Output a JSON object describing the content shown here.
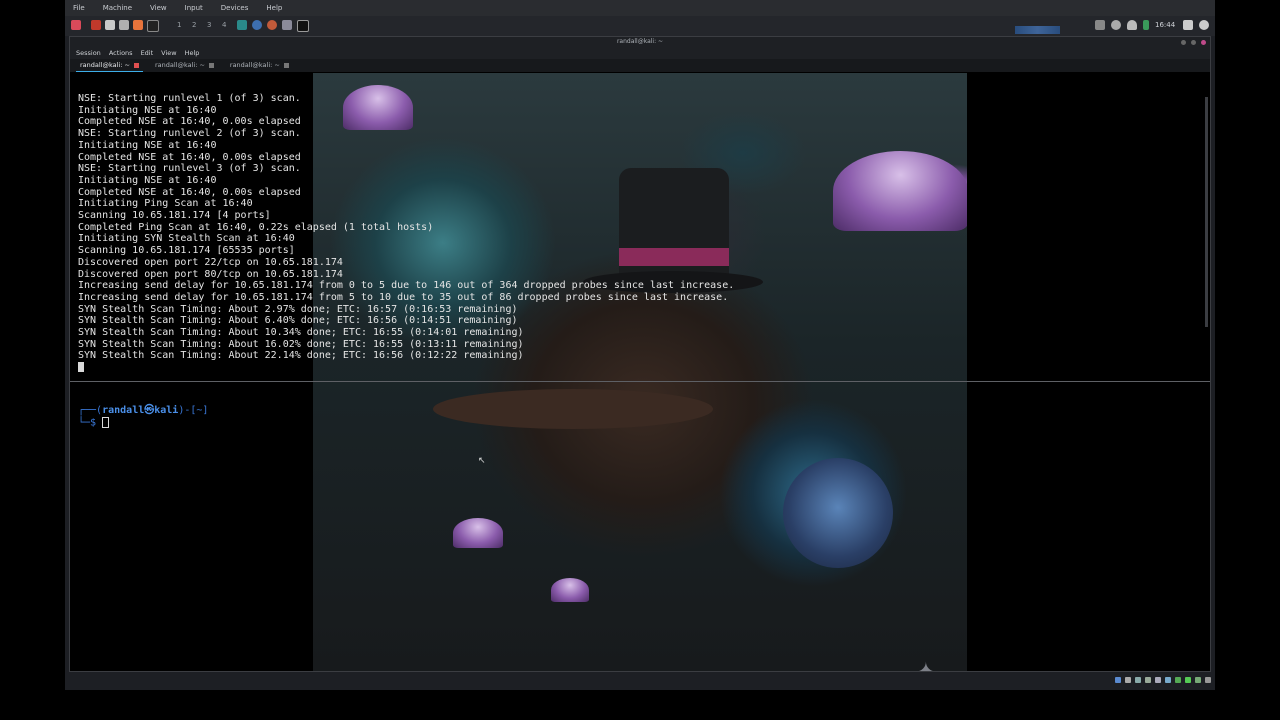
{
  "vbox_menu": [
    "File",
    "Machine",
    "View",
    "Input",
    "Devices",
    "Help"
  ],
  "panel": {
    "workspaces": [
      "1",
      "2",
      "3",
      "4"
    ],
    "clock": "16:44"
  },
  "terminal": {
    "title": "randall@kali: ~",
    "menu": [
      "Session",
      "Actions",
      "Edit",
      "View",
      "Help"
    ],
    "tabs": [
      "randall@kali: ~",
      "randall@kali: ~",
      "randall@kali: ~"
    ],
    "output_lines": [
      "NSE: Starting runlevel 1 (of 3) scan.",
      "Initiating NSE at 16:40",
      "Completed NSE at 16:40, 0.00s elapsed",
      "NSE: Starting runlevel 2 (of 3) scan.",
      "Initiating NSE at 16:40",
      "Completed NSE at 16:40, 0.00s elapsed",
      "NSE: Starting runlevel 3 (of 3) scan.",
      "Initiating NSE at 16:40",
      "Completed NSE at 16:40, 0.00s elapsed",
      "Initiating Ping Scan at 16:40",
      "Scanning 10.65.181.174 [4 ports]",
      "Completed Ping Scan at 16:40, 0.22s elapsed (1 total hosts)",
      "Initiating SYN Stealth Scan at 16:40",
      "Scanning 10.65.181.174 [65535 ports]",
      "Discovered open port 22/tcp on 10.65.181.174",
      "Discovered open port 80/tcp on 10.65.181.174",
      "Increasing send delay for 10.65.181.174 from 0 to 5 due to 146 out of 364 dropped probes since last increase.",
      "Increasing send delay for 10.65.181.174 from 5 to 10 due to 35 out of 86 dropped probes since last increase.",
      "SYN Stealth Scan Timing: About 2.97% done; ETC: 16:57 (0:16:53 remaining)",
      "SYN Stealth Scan Timing: About 6.40% done; ETC: 16:56 (0:14:51 remaining)",
      "SYN Stealth Scan Timing: About 10.34% done; ETC: 16:55 (0:14:01 remaining)",
      "SYN Stealth Scan Timing: About 16.02% done; ETC: 16:55 (0:13:11 remaining)",
      "SYN Stealth Scan Timing: About 22.14% done; ETC: 16:56 (0:12:22 remaining)"
    ],
    "prompt": {
      "line1_prefix": "┌──(",
      "user_host": "randall㉿kali",
      "line1_suffix": ")-[~]",
      "line2": "└─$ "
    }
  }
}
